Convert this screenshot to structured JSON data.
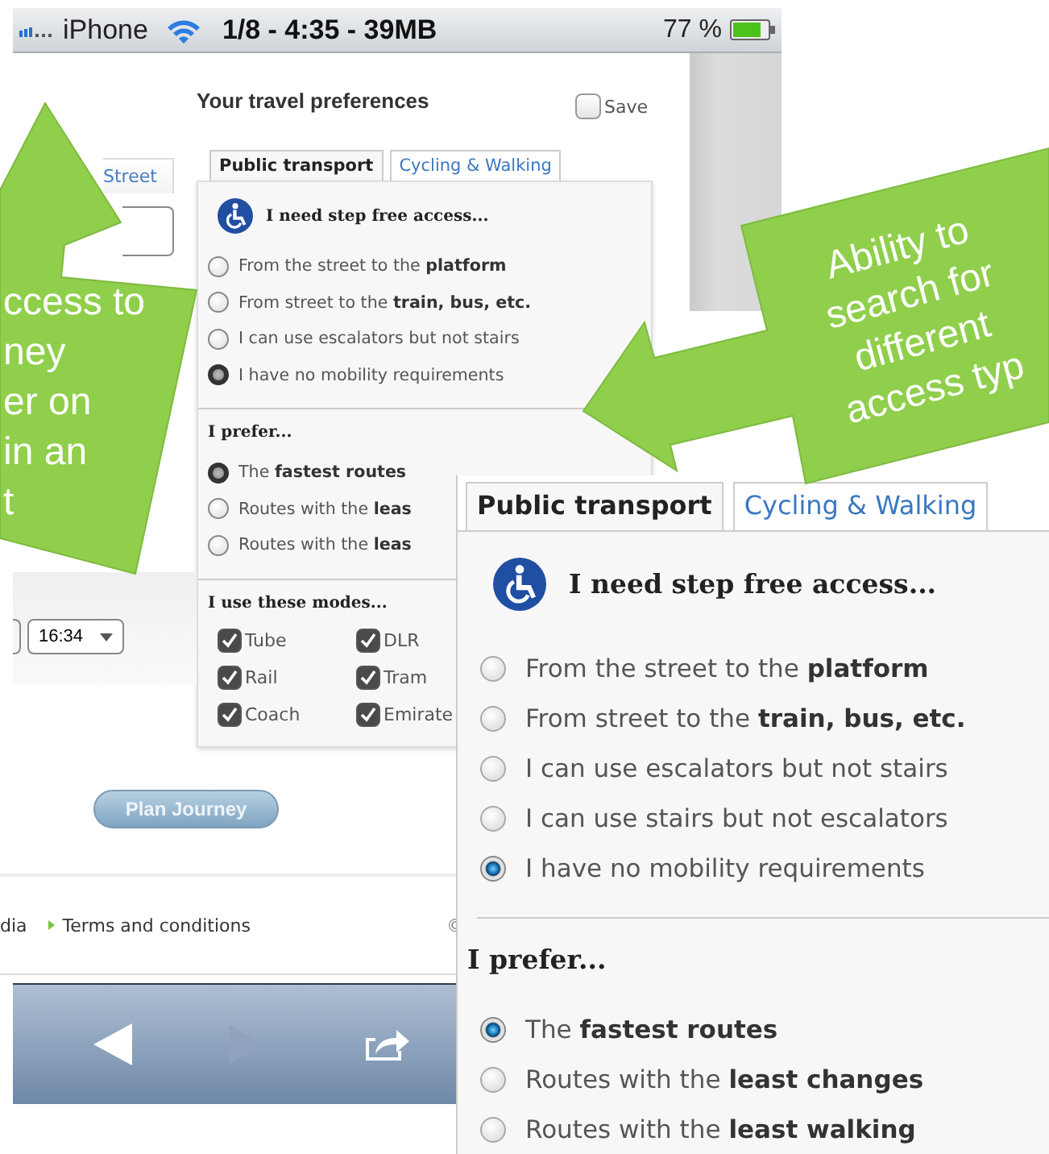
{
  "status_bar": {
    "carrier": "iPhone",
    "info": "1/8 - 4:35 - 39MB",
    "battery": "77 %"
  },
  "page": {
    "street_tab": "Street",
    "time_select": "16:34",
    "plan_button": "Plan Journey",
    "footer_links": [
      "dia",
      "Terms and conditions"
    ],
    "copyright": "©"
  },
  "preferences": {
    "title": "Your travel preferences",
    "save": {
      "label": "Save",
      "checked": false
    },
    "tabs": [
      {
        "label": "Public transport",
        "selected": true
      },
      {
        "label": "Cycling & Walking",
        "selected": false
      }
    ],
    "step_free": {
      "heading": "I need step free access...",
      "options": [
        {
          "label": "From the street to the **platform**",
          "selected": false
        },
        {
          "label": "From street to the **train, bus, etc.**",
          "selected": false
        },
        {
          "label": "I can use escalators but not stairs",
          "selected": false
        },
        {
          "label": "I have no mobility requirements",
          "selected": true
        }
      ]
    },
    "prefer": {
      "heading": "I prefer...",
      "options": [
        {
          "label": "The **fastest routes**",
          "selected": true
        },
        {
          "label": "Routes with the **leas**",
          "selected": false
        },
        {
          "label": "Routes with the **leas**",
          "selected": false
        }
      ]
    },
    "modes": {
      "heading": "I use these modes...",
      "items": [
        {
          "label": "Tube",
          "checked": true
        },
        {
          "label": "DLR",
          "checked": true
        },
        {
          "label": "Rail",
          "checked": true
        },
        {
          "label": "Tram",
          "checked": true
        },
        {
          "label": "Coach",
          "checked": true
        },
        {
          "label": "Emirate",
          "checked": true
        }
      ]
    }
  },
  "zoom_inset": {
    "tabs": [
      {
        "label": "Public transport",
        "selected": true
      },
      {
        "label": "Cycling & Walking",
        "selected": false
      }
    ],
    "step_free": {
      "heading": "I need step free access...",
      "options": [
        {
          "label": "From the street to the **platform**",
          "selected": false
        },
        {
          "label": "From street to the **train, bus, etc.**",
          "selected": false
        },
        {
          "label": "I can use escalators but not stairs",
          "selected": false
        },
        {
          "label": "I can use stairs but not escalators",
          "selected": false
        },
        {
          "label": "I have no mobility requirements",
          "selected": true
        }
      ]
    },
    "prefer": {
      "heading": "I prefer...",
      "options": [
        {
          "label": "The **fastest routes**",
          "selected": true
        },
        {
          "label": "Routes with the **least changes**",
          "selected": false
        },
        {
          "label": "Routes with the **least walking**",
          "selected": false
        }
      ]
    }
  },
  "callouts": [
    {
      "lines": [
        "ccess to",
        "ney",
        "er on",
        "in an",
        "t"
      ]
    },
    {
      "lines": [
        "Ability to",
        "search for",
        "different",
        "access typ"
      ]
    }
  ]
}
